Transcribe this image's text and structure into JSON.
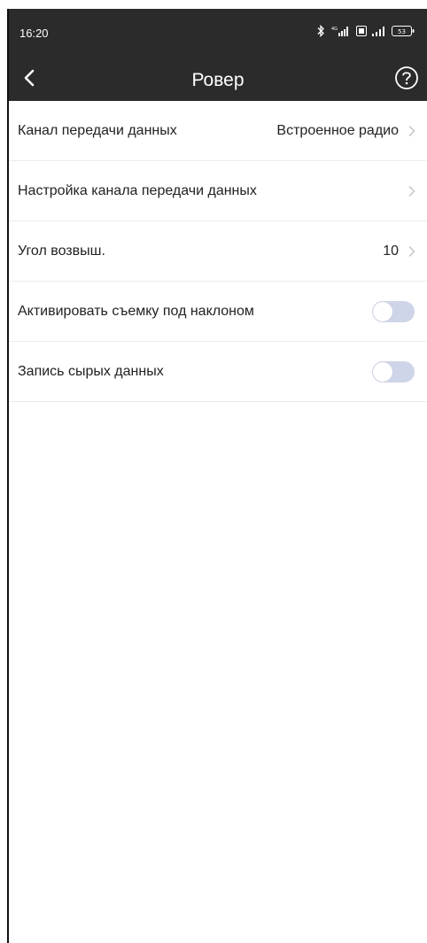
{
  "status_bar": {
    "time": "16:20",
    "battery": "53"
  },
  "nav": {
    "title": "Ровер",
    "back_icon": "chevron-left-icon",
    "help_icon": "question-circle-icon"
  },
  "settings": [
    {
      "label": "Канал передачи данных",
      "value": "Встроенное радио",
      "type": "link"
    },
    {
      "label": "Настройка канала передачи данных",
      "value": "",
      "type": "link"
    },
    {
      "label": "Угол возвыш.",
      "value": "10",
      "type": "link"
    },
    {
      "label": "Активировать съемку под наклоном",
      "type": "toggle",
      "on": false
    },
    {
      "label": "Запись сырых данных",
      "type": "toggle",
      "on": false
    }
  ],
  "colors": {
    "topbar": "#2b2b2b",
    "toggle_off": "#cfd5e8",
    "divider": "#ececec",
    "chevron": "#c4c4c4"
  }
}
